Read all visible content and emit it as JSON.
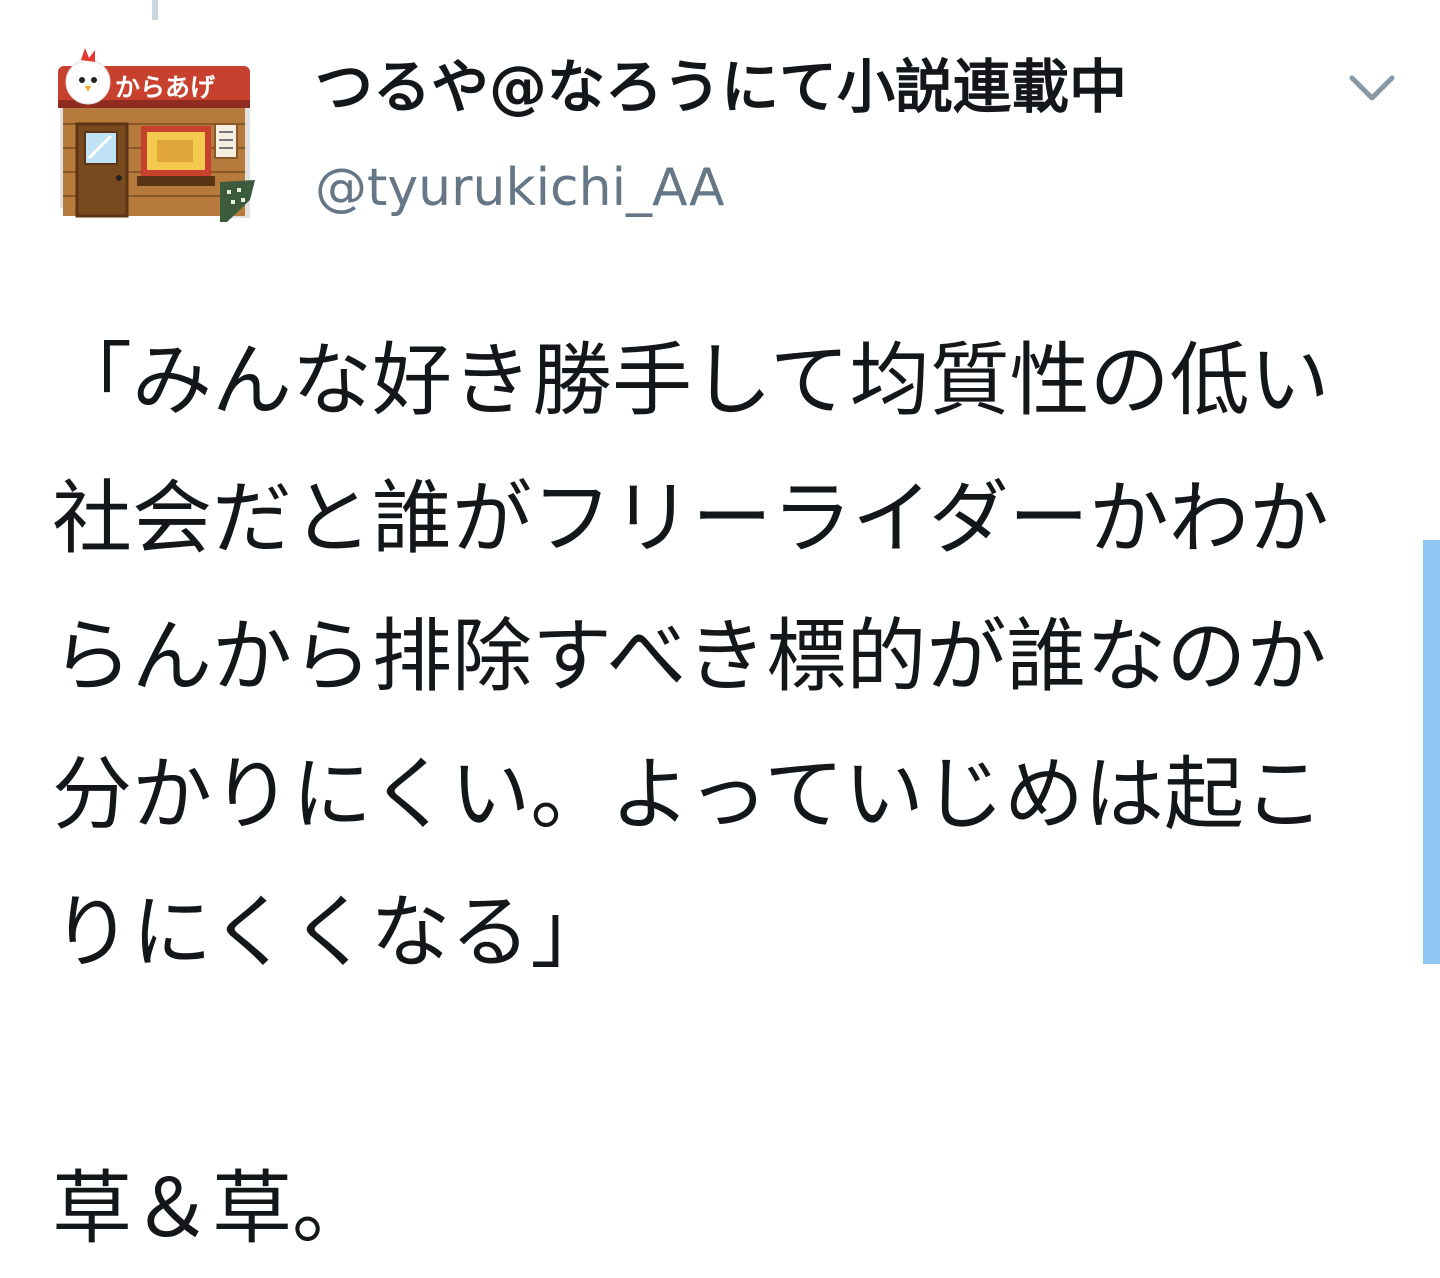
{
  "tweet": {
    "author": {
      "display_name": "つるや@なろうにて小説連載中",
      "handle": "@tyurukichi_AA",
      "avatar_sign": "からあげ"
    },
    "menu_icon": "chevron-down-icon",
    "text": "「みんな好き勝手して均質性の低い社会だと誰がフリーライダーかわからんから排除すべき標的が誰なのか分かりにくい。よっていじめは起こりにくくなる」\n\n草＆草。"
  },
  "colors": {
    "name": "#14171a",
    "handle": "#657786",
    "body_text": "#14171a",
    "scrollbar": "#8ec8f2",
    "thread_line": "#ccd6dd"
  }
}
